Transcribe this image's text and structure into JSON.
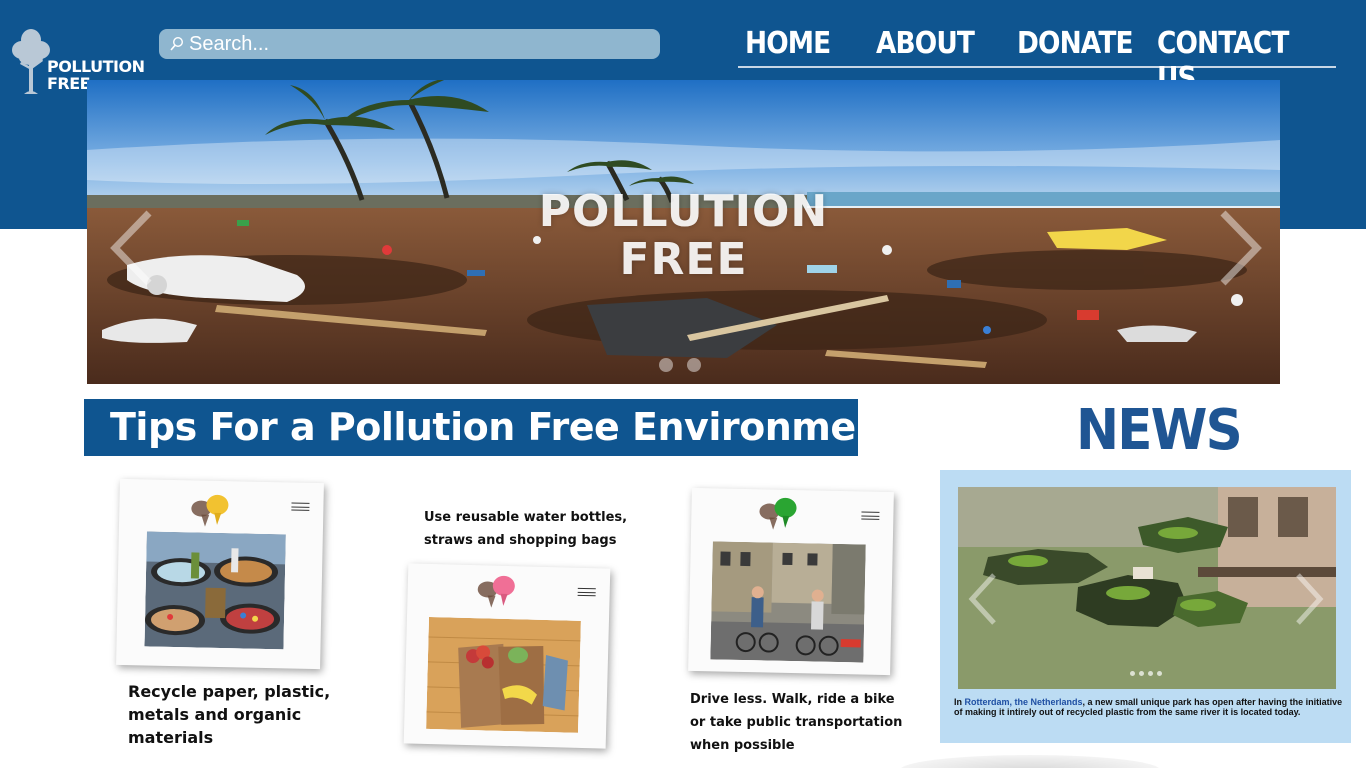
{
  "brand": {
    "logo_text_line1": "POLLUTION",
    "logo_text_line2": "FREE",
    "primary_color": "#0f5590",
    "logo_icon": "tree-icon"
  },
  "search": {
    "placeholder": "Search...",
    "icon": "search-icon"
  },
  "nav": {
    "items": [
      {
        "label": "HOME"
      },
      {
        "label": "ABOUT"
      },
      {
        "label": "DONATE"
      },
      {
        "label": "CONTACT US"
      }
    ]
  },
  "hero": {
    "title_line1": "POLLUTION",
    "title_line2": "FREE",
    "prev_icon": "chevron-left-icon",
    "next_icon": "chevron-right-icon",
    "slide_count": 2
  },
  "tips": {
    "heading": "Tips For a Pollution Free Environment",
    "items": [
      {
        "text_line1": "Recycle paper, plastic,",
        "text_line2": "metals and organic",
        "text_line3": "materials",
        "pin_color": "#f2c230"
      },
      {
        "text_line1": "Use reusable water bottles,",
        "text_line2": "straws and shopping bags",
        "pin_color": "#f06f96"
      },
      {
        "text_line1": "Drive less. Walk, ride a bike",
        "text_line2": "or take public transportation",
        "text_line3": "when possible",
        "pin_color": "#2aa532"
      }
    ]
  },
  "news": {
    "heading": "NEWS",
    "box_color": "#bcdcf3",
    "story_prefix": "In ",
    "story_location": "Rotterdam, the Netherlands",
    "story_body": ", a new small unique park has open after having the initiative of making it intirely out of recycled plastic from the same river it is located today.",
    "slide_count": 4
  }
}
